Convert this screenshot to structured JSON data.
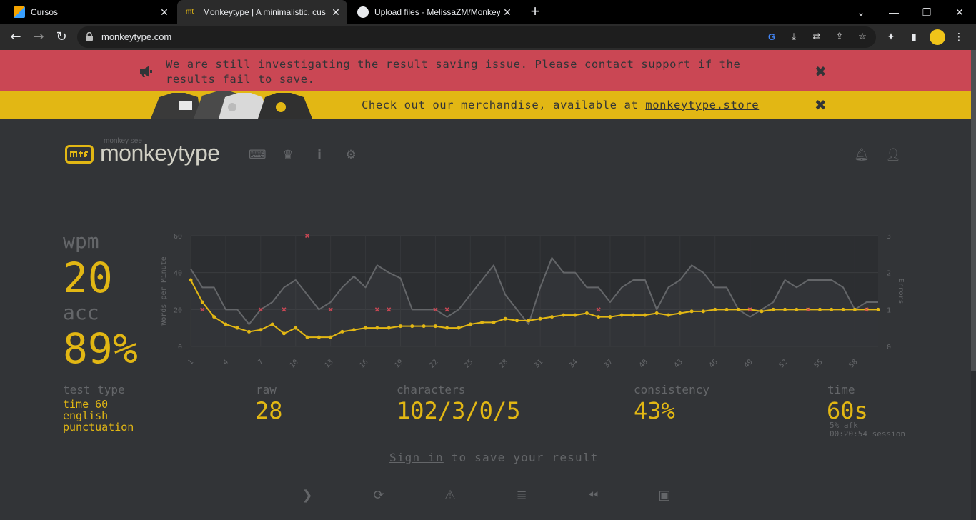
{
  "browser": {
    "tabs": [
      {
        "title": "Cursos",
        "active": false
      },
      {
        "title": "Monkeytype | A minimalistic, cus",
        "active": true
      },
      {
        "title": "Upload files · MelissaZM/Monkey",
        "active": false
      }
    ],
    "url": "monkeytype.com"
  },
  "banners": {
    "alert": "We are still investigating the result saving issue. Please contact support if the results fail to save.",
    "merch_text": "Check out our merchandise, available at ",
    "merch_link": "monkeytype.store"
  },
  "header": {
    "logo_small": "monkey see",
    "logo": "monkeytype",
    "logo_icon": "mt"
  },
  "stats": {
    "wpm_label": "wpm",
    "wpm": "20",
    "acc_label": "acc",
    "acc": "89%",
    "test_type_label": "test type",
    "test_type": [
      "time 60",
      "english",
      "punctuation"
    ],
    "raw_label": "raw",
    "raw": "28",
    "characters_label": "characters",
    "characters": "102/3/0/5",
    "consistency_label": "consistency",
    "consistency": "43%",
    "time_label": "time",
    "time": "60s",
    "afk": "5% afk",
    "session": "00:20:54 session"
  },
  "signin": {
    "link": "Sign in",
    "rest": " to save your result"
  },
  "colors": {
    "main": "#e2b714",
    "sub": "#646669",
    "bg": "#323437",
    "error": "#ca4754",
    "text": "#d1d0c5"
  },
  "chart_data": {
    "type": "line",
    "ylabel": "Words per Minute",
    "y2label": "Errors",
    "ylim": [
      0,
      60
    ],
    "y2lim": [
      0,
      3
    ],
    "yticks": [
      "0",
      "20",
      "40",
      "60"
    ],
    "y2ticks": [
      "0",
      "1",
      "2",
      "3"
    ],
    "xticks": [
      "1",
      "4",
      "7",
      "10",
      "13",
      "16",
      "19",
      "22",
      "25",
      "28",
      "31",
      "34",
      "37",
      "40",
      "43",
      "46",
      "49",
      "52",
      "55",
      "58"
    ],
    "x": [
      1,
      2,
      3,
      4,
      5,
      6,
      7,
      8,
      9,
      10,
      11,
      12,
      13,
      14,
      15,
      16,
      17,
      18,
      19,
      20,
      21,
      22,
      23,
      24,
      25,
      26,
      27,
      28,
      29,
      30,
      31,
      32,
      33,
      34,
      35,
      36,
      37,
      38,
      39,
      40,
      41,
      42,
      43,
      44,
      45,
      46,
      47,
      48,
      49,
      50,
      51,
      52,
      53,
      54,
      55,
      56,
      57,
      58,
      59,
      60
    ],
    "series": [
      {
        "name": "raw",
        "color": "#646669",
        "values": [
          42,
          32,
          32,
          20,
          20,
          12,
          20,
          24,
          32,
          36,
          28,
          20,
          24,
          32,
          38,
          32,
          44,
          40,
          37,
          20,
          20,
          20,
          16,
          20,
          28,
          36,
          44,
          28,
          20,
          12,
          32,
          48,
          40,
          40,
          32,
          32,
          24,
          32,
          36,
          36,
          20,
          32,
          36,
          44,
          40,
          32,
          32,
          20,
          16,
          20,
          24,
          36,
          32,
          36,
          36,
          36,
          32,
          20,
          24,
          24
        ]
      },
      {
        "name": "wpm",
        "color": "#e2b714",
        "values": [
          36,
          24,
          16,
          12,
          10,
          8,
          9,
          12,
          7,
          10,
          5,
          5,
          5,
          8,
          9,
          10,
          10,
          10,
          11,
          11,
          11,
          11,
          10,
          10,
          12,
          13,
          13,
          15,
          14,
          14,
          15,
          16,
          17,
          17,
          18,
          16,
          16,
          17,
          17,
          17,
          18,
          17,
          18,
          19,
          19,
          20,
          20,
          20,
          20,
          19,
          20,
          20,
          20,
          20,
          20,
          20,
          20,
          20,
          20,
          20
        ]
      },
      {
        "name": "errors",
        "color": "#ca4754",
        "points": [
          [
            2,
            1
          ],
          [
            7,
            1
          ],
          [
            9,
            1
          ],
          [
            11,
            3
          ],
          [
            13,
            1
          ],
          [
            17,
            1
          ],
          [
            18,
            1
          ],
          [
            22,
            1
          ],
          [
            23,
            1
          ],
          [
            36,
            1
          ],
          [
            49,
            1
          ],
          [
            54,
            1
          ],
          [
            59,
            1
          ]
        ]
      }
    ]
  }
}
